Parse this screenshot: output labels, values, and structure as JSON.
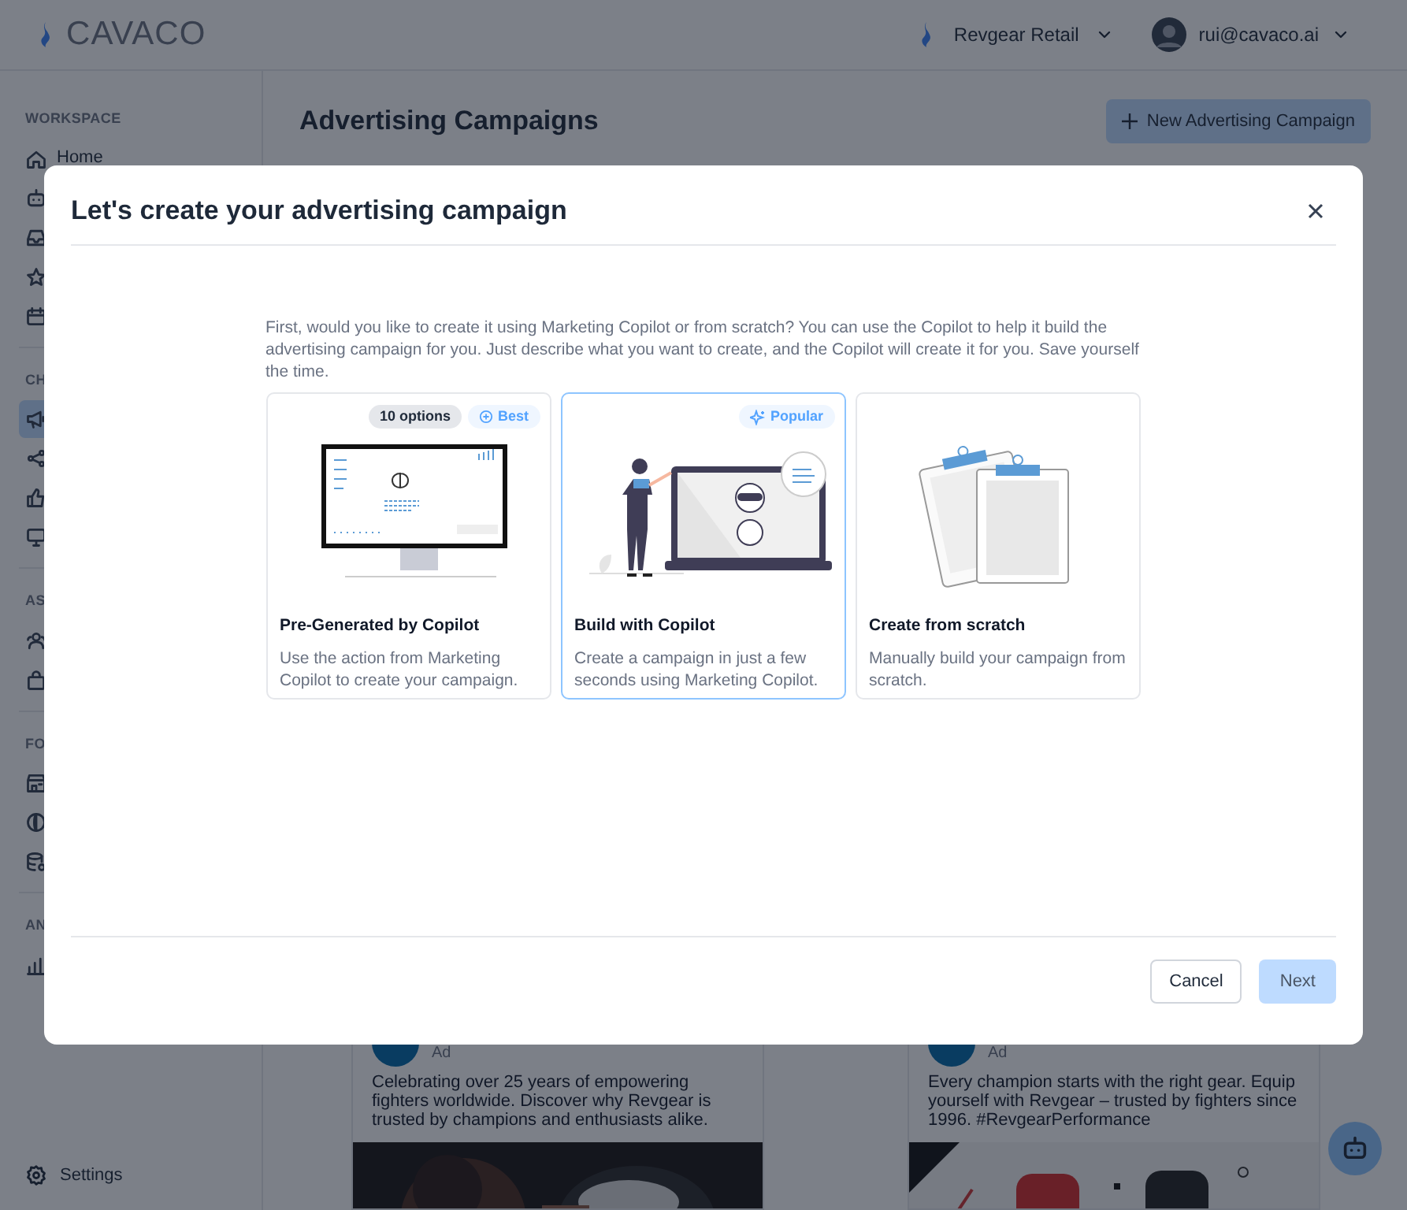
{
  "header": {
    "logo": "CAVACO",
    "organization": "Revgear Retail",
    "user": "rui@cavaco.ai"
  },
  "sidebar": {
    "sections": [
      {
        "label": "WORKSPACE",
        "items": [
          {
            "label": "Home",
            "selected": false
          },
          {
            "selected": false
          },
          {
            "selected": false
          },
          {
            "selected": false
          },
          {
            "selected": false
          }
        ]
      },
      {
        "label": "CH",
        "items": [
          {
            "selected": true
          },
          {
            "selected": false
          },
          {
            "selected": false
          },
          {
            "selected": false
          }
        ]
      },
      {
        "label": "AS",
        "items": [
          {
            "selected": false
          },
          {
            "selected": false
          }
        ]
      },
      {
        "label": "FO",
        "items": [
          {
            "selected": false
          },
          {
            "selected": false
          },
          {
            "selected": false
          }
        ]
      },
      {
        "label": "AN",
        "items": [
          {
            "selected": false
          }
        ]
      }
    ],
    "settings": "Settings"
  },
  "page": {
    "title": "Advertising Campaigns",
    "new_button": "New Advertising Campaign"
  },
  "posts": [
    {
      "meta": "Ad",
      "text": "Celebrating over 25 years of empowering fighters worldwide. Discover why Revgear is trusted by champions and enthusiasts alike."
    },
    {
      "meta": "Ad",
      "text": "Every champion starts with the right gear. Equip yourself with Revgear – trusted by fighters since 1996. #RevgearPerformance"
    }
  ],
  "modal": {
    "title": "Let's create your advertising campaign",
    "intro": "First, would you like to create it using Marketing Copilot or from scratch? You can use the Copilot to help it build the advertising campaign for you. Just describe what you want to create, and the Copilot will create it for you. Save yourself the time.",
    "options": [
      {
        "kind": "pregenerated",
        "title": "Pre-Generated by Copilot",
        "description": "Use the action from Marketing Copilot to create your campaign.",
        "selected": false,
        "badges": [
          {
            "kind": "count",
            "text": "10 options"
          },
          {
            "kind": "best",
            "text": "Best"
          }
        ]
      },
      {
        "kind": "copilot",
        "title": "Build with Copilot",
        "description": "Create a campaign in just a few seconds using Marketing Copilot.",
        "selected": true,
        "badges": [
          {
            "kind": "popular",
            "text": "Popular"
          }
        ]
      },
      {
        "kind": "scratch",
        "title": "Create from scratch",
        "description": "Manually build your campaign from scratch.",
        "selected": false
      }
    ],
    "cancel": "Cancel",
    "next": {
      "label": "Next",
      "disabled": true
    }
  }
}
